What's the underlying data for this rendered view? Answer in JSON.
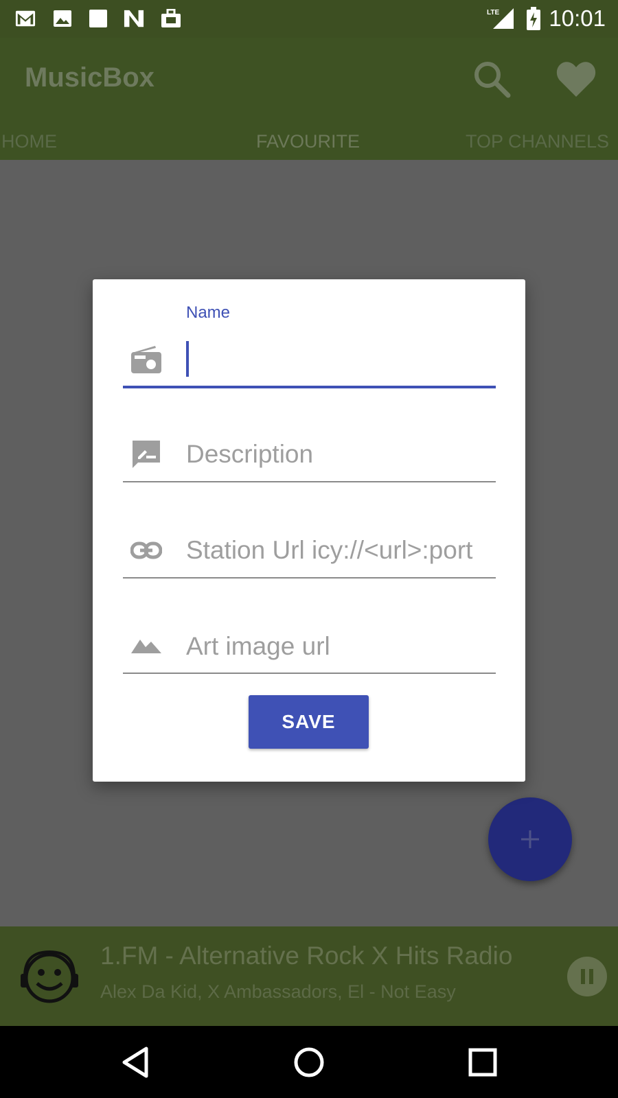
{
  "status_bar": {
    "time": "10:01",
    "network": "LTE",
    "icons": [
      "gmail-icon",
      "image-icon",
      "square-icon",
      "n-icon",
      "briefcase-icon",
      "lte-signal-icon",
      "battery-charging-icon"
    ]
  },
  "app_bar": {
    "title": "MusicBox",
    "icons": [
      "search-icon",
      "heart-icon"
    ]
  },
  "tabs": [
    {
      "label": "HOME"
    },
    {
      "label": "FAVOURITE"
    },
    {
      "label": "TOP CHANNELS"
    }
  ],
  "dialog": {
    "name_label": "Name",
    "fields": [
      {
        "icon": "radio-icon",
        "value": "",
        "placeholder": ""
      },
      {
        "icon": "description-icon",
        "value": "",
        "placeholder": "Description"
      },
      {
        "icon": "link-icon",
        "value": "",
        "placeholder": "Station Url icy://<url>:port"
      },
      {
        "icon": "landscape-icon",
        "value": "",
        "placeholder": "Art image url"
      }
    ],
    "save_label": "SAVE"
  },
  "fab": {
    "icon": "plus-icon"
  },
  "player": {
    "title": "1.FM - Alternative Rock X Hits Radio",
    "artist": "Alex Da Kid, X Ambassadors, El - Not Easy",
    "avatar_icon": "smiley-headphones-icon",
    "pause_icon": "pause-icon"
  },
  "nav_bar": {
    "icons": [
      "back-icon",
      "home-icon",
      "recents-icon"
    ]
  },
  "colors": {
    "primary": "#3f51b5",
    "app_bar_dimmed": "#3e5223",
    "overlay": "#5f5f5f",
    "fab": "#22297a"
  }
}
